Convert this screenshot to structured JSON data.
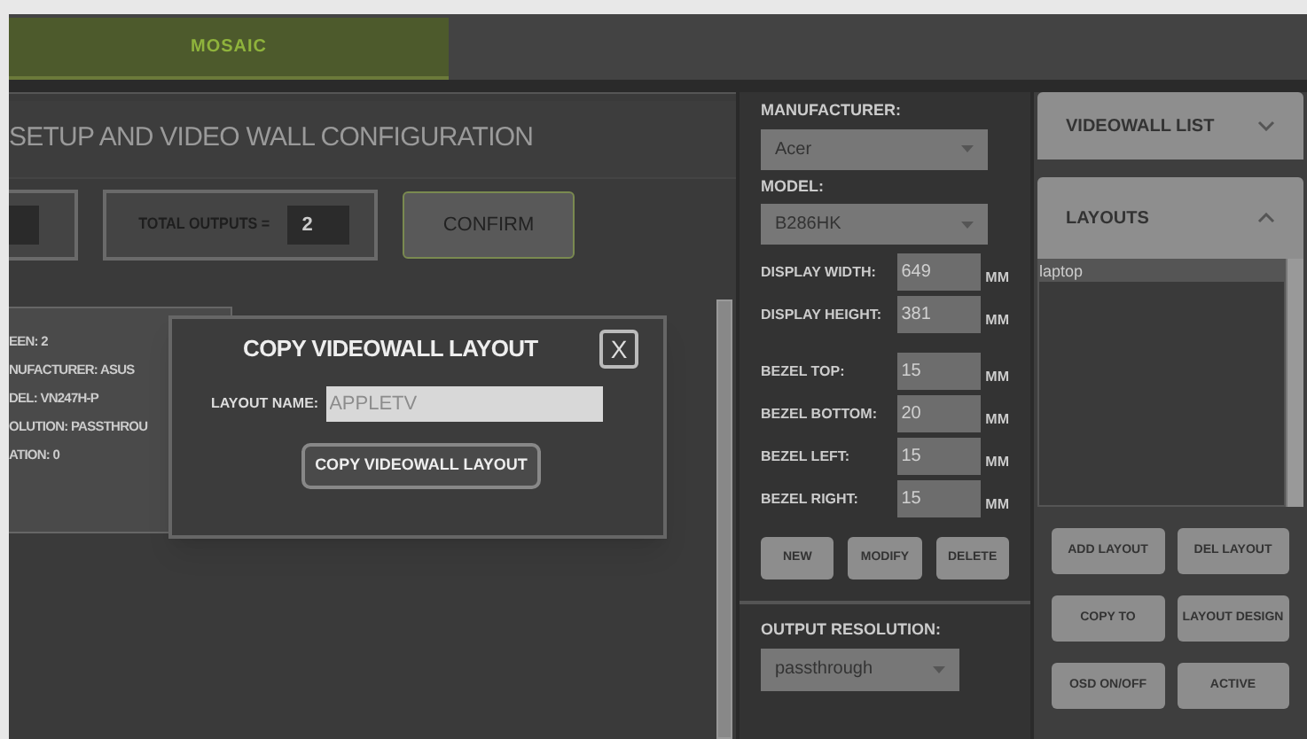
{
  "top_tabs": [
    {
      "label": "MOSAIC",
      "selected": true
    }
  ],
  "setup": {
    "title": "SETUP AND VIDEO WALL CONFIGURATION",
    "total_outputs": {
      "label": "TOTAL OUTPUTS =",
      "value": "2"
    },
    "confirm_button": "CONFIRM",
    "screen_card": [
      "EEN: 2",
      "NUFACTURER: ASUS",
      "DEL: VN247H-P",
      "OLUTION: PASSTHROU",
      "ATION: 0"
    ]
  },
  "dialog": {
    "title": "COPY VIDEOWALL LAYOUT",
    "close": "X",
    "field_label": "LAYOUT NAME:",
    "placeholder": "APPLETV",
    "button": "COPY VIDEOWALL LAYOUT"
  },
  "display_settings": {
    "manufacturer": {
      "label": "MANUFACTURER:",
      "value": "Acer"
    },
    "model": {
      "label": "MODEL:",
      "value": "B286HK"
    },
    "size_fields": [
      {
        "label": "DISPLAY WIDTH:",
        "value": "649",
        "unit": "MM"
      },
      {
        "label": "DISPLAY HEIGHT:",
        "value": "381",
        "unit": "MM"
      }
    ],
    "bezel_fields": [
      {
        "label": "BEZEL TOP:",
        "value": "15",
        "unit": "MM"
      },
      {
        "label": "BEZEL BOTTOM:",
        "value": "20",
        "unit": "MM"
      },
      {
        "label": "BEZEL LEFT:",
        "value": "15",
        "unit": "MM"
      },
      {
        "label": "BEZEL RIGHT:",
        "value": "15",
        "unit": "MM"
      }
    ],
    "buttons": [
      "NEW",
      "MODIFY",
      "DELETE"
    ],
    "output_resolution": {
      "label": "OUTPUT RESOLUTION:",
      "value": "passthrough"
    }
  },
  "sidebar": {
    "sections": [
      {
        "title": "VIDEOWALL LIST",
        "expanded": false
      },
      {
        "title": "LAYOUTS",
        "expanded": true
      }
    ],
    "layouts": [
      {
        "name": "laptop",
        "selected": true
      }
    ],
    "buttons": [
      "ADD LAYOUT",
      "DEL LAYOUT",
      "COPY TO",
      "LAYOUT DESIGN",
      "OSD ON/OFF",
      "ACTIVE"
    ]
  }
}
